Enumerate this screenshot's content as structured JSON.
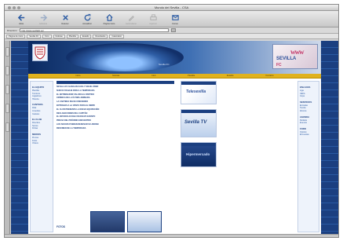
{
  "window": {
    "title": "Mundo del Sevilla - CSA"
  },
  "toolbar": {
    "buttons": [
      {
        "label": "Atrás",
        "icon": "back-arrow-icon",
        "enabled": true
      },
      {
        "label": "Adelante",
        "icon": "forward-arrow-icon",
        "enabled": false
      },
      {
        "label": "Detener",
        "icon": "stop-x-icon",
        "enabled": true
      },
      {
        "label": "Actualizar",
        "icon": "refresh-icon",
        "enabled": true
      },
      {
        "label": "Página inicio",
        "icon": "home-icon",
        "enabled": true
      },
      {
        "label": "Autorrelleno",
        "icon": "pen-icon",
        "enabled": false
      },
      {
        "label": "Imprimir",
        "icon": "printer-icon",
        "enabled": false
      },
      {
        "label": "Correo",
        "icon": "mail-icon",
        "enabled": true
      }
    ]
  },
  "address": {
    "label": "Dirección",
    "url": "http://www.sevillafc.es/"
  },
  "favorites": [
    "Página de inicio",
    "Sevilla FC",
    "Foro",
    "Noticias",
    "Plantilla",
    "Estadio",
    "Resultados",
    "Calendario"
  ],
  "site": {
    "banner_caption": "Sevilla FC",
    "promo": {
      "line1": "www",
      "line2": "SEVILLA",
      "line3": "FC"
    },
    "nav": [
      "Inicio",
      "Noticias",
      "Club",
      "Plantilla",
      "Estadio",
      "Contacto"
    ],
    "left_menu": [
      {
        "heading": "EL EQUIPO",
        "items": [
          "Plantilla",
          "Técnicos",
          "Jugadores",
          "Historia"
        ]
      },
      {
        "heading": "CANTERA",
        "items": [
          "Filial",
          "Juveniles",
          "Cadetes"
        ]
      },
      {
        "heading": "EL CLUB",
        "items": [
          "Directiva",
          "Socios",
          "Peñas"
        ]
      },
      {
        "heading": "MEDIOS",
        "items": [
          "Prensa",
          "Fotos",
          "Vídeos"
        ]
      }
    ],
    "right_menu": [
      {
        "heading": "ENLACES",
        "items": [
          "Liga",
          "UEFA",
          "Copa"
        ]
      },
      {
        "heading": "SERVICIOS",
        "items": [
          "Entradas",
          "Tienda",
          "Abonos"
        ]
      },
      {
        "heading": "AGENDA",
        "items": [
          "Partidos",
          "Eventos"
        ]
      },
      {
        "heading": "FORO",
        "items": [
          "Opinión",
          "Encuestas"
        ]
      }
    ],
    "news": [
      "SEVILLA FC GANA EN CASA Y SIGUE LÍDER",
      "NUEVO FICHAJE PARA LA TEMPORADA",
      "EL ENTRENADOR VALORA EL PARTIDO",
      "CRÓNICA DE LA ÚLTIMA JORNADA",
      "LA CANTERA SIGUE CRECIENDO",
      "ENTRADAS A LA VENTA PARA EL DERBI",
      "EL CLUB PRESENTA LA NUEVA EQUIPACIÓN",
      "DECLARACIONES DEL CAPITÁN",
      "EL ESTADIO ACOGE UN NUEVO EVENTO",
      "PREVIA DEL PRÓXIMO ENCUENTRO",
      "LOS SOCIOS PUEDEN RENOVAR SU ABONO",
      "RESUMEN DE LA TEMPORADA"
    ],
    "photo_label": "FOTOS",
    "ads": [
      "Telesevilla",
      "Sevilla TV",
      "Hipermercado"
    ]
  },
  "colors": {
    "accent": "#1b3f80",
    "nav": "#e0b21d",
    "page_bg": "#0e2f6b"
  }
}
